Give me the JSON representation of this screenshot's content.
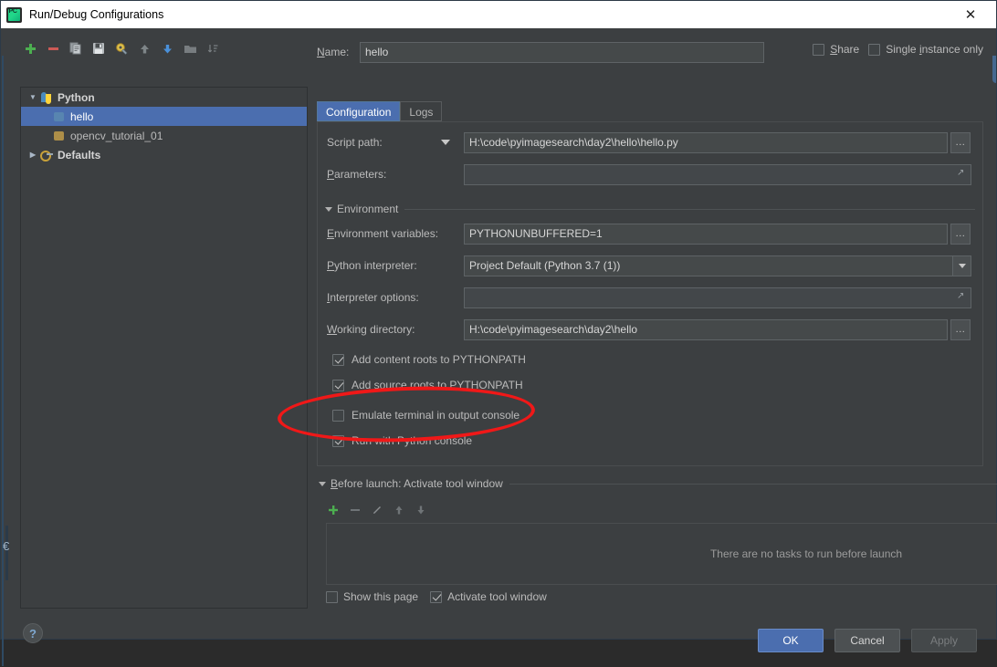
{
  "window": {
    "title": "Run/Debug Configurations",
    "app_icon": "pycharm-logo-icon",
    "close_icon": "close-icon"
  },
  "toolbar": {
    "buttons": [
      {
        "name": "add-configuration-button",
        "icon": "plus-icon",
        "glyph": "+",
        "color": "#4caf50",
        "enabled": true
      },
      {
        "name": "remove-configuration-button",
        "icon": "minus-icon",
        "glyph": "−",
        "color": "#d9534f",
        "enabled": true
      },
      {
        "name": "copy-configuration-button",
        "icon": "copy-icon",
        "glyph": "⎘",
        "color": "#b9bdc0",
        "enabled": true
      },
      {
        "name": "save-configuration-button",
        "icon": "save-icon",
        "glyph": "ὋE",
        "color": "#b9bdc0",
        "enabled": true
      },
      {
        "name": "edit-defaults-button",
        "icon": "gear-key-icon",
        "glyph": "⚙",
        "color": "#d6b34a",
        "enabled": true
      },
      {
        "name": "move-up-button",
        "icon": "arrow-up-icon",
        "glyph": "↑",
        "color": "#7f8486",
        "enabled": false
      },
      {
        "name": "move-down-button",
        "icon": "arrow-down-icon",
        "glyph": "↓",
        "color": "#4a90d9",
        "enabled": true
      },
      {
        "name": "new-folder-button",
        "icon": "folder-icon",
        "glyph": "▬",
        "color": "#8b8f92",
        "enabled": true
      },
      {
        "name": "sort-configurations-button",
        "icon": "sort-icon",
        "glyph": "⇅",
        "color": "#7f8486",
        "enabled": false
      }
    ]
  },
  "tree": {
    "nodes": [
      {
        "label": "Python",
        "level": 0,
        "type": "group",
        "expanded": true,
        "icon": "python-icon",
        "selected": false
      },
      {
        "label": "hello",
        "level": 1,
        "type": "config",
        "icon": "config-icon",
        "selected": true
      },
      {
        "label": "opencv_tutorial_01",
        "level": 1,
        "type": "config",
        "icon": "config-icon",
        "selected": false
      },
      {
        "label": "Defaults",
        "level": 0,
        "type": "group",
        "expanded": false,
        "icon": "defaults-icon",
        "selected": false
      }
    ]
  },
  "header": {
    "name_label": "Name:",
    "name_label_mnemonic": "N",
    "name_value": "hello",
    "share_label": "Share",
    "share_mnemonic": "S",
    "share_checked": false,
    "single_instance_label": "Single instance only",
    "single_instance_mnemonic": "i",
    "single_instance_checked": false
  },
  "tabs": [
    {
      "label": "Configuration",
      "active": true
    },
    {
      "label": "Logs",
      "active": false
    }
  ],
  "form": {
    "script_path": {
      "label": "Script path:",
      "value": "H:\\code\\pyimagesearch\\day2\\hello\\hello.py",
      "browse_label": "...",
      "has_mode_dropdown": true
    },
    "parameters": {
      "label": "Parameters:",
      "mnemonic": "P",
      "value": "",
      "expand_icon": "expand-editor-icon"
    },
    "environment_section": {
      "label": "Environment",
      "expanded": true
    },
    "environment_variables": {
      "label": "Environment variables:",
      "mnemonic": "E",
      "value": "PYTHONUNBUFFERED=1",
      "browse_label": "..."
    },
    "python_interpreter": {
      "label": "Python interpreter:",
      "mnemonic": "P",
      "value": "Project Default (Python 3.7 (1))"
    },
    "interpreter_options": {
      "label": "Interpreter options:",
      "mnemonic": "I",
      "value": "",
      "expand_icon": "expand-editor-icon"
    },
    "working_directory": {
      "label": "Working directory:",
      "mnemonic": "W",
      "value": "H:\\code\\pyimagesearch\\day2\\hello",
      "browse_label": "..."
    },
    "checkboxes": [
      {
        "label": "Add content roots to PYTHONPATH",
        "checked": true,
        "name": "add-content-roots-checkbox"
      },
      {
        "label": "Add source roots to PYTHONPATH",
        "checked": true,
        "name": "add-source-roots-checkbox"
      },
      {
        "label": "Emulate terminal in output console",
        "checked": false,
        "name": "emulate-terminal-checkbox"
      },
      {
        "label": "Run with Python console",
        "checked": true,
        "name": "run-with-python-console-checkbox"
      }
    ]
  },
  "before_launch": {
    "section_label": "Before launch: Activate tool window",
    "mnemonic": "B",
    "expanded": true,
    "toolbar": [
      {
        "name": "bl-add-button",
        "icon": "plus-icon",
        "glyph": "+",
        "color": "#4caf50",
        "enabled": true
      },
      {
        "name": "bl-remove-button",
        "icon": "minus-icon",
        "glyph": "−",
        "color": "#7f8486",
        "enabled": false
      },
      {
        "name": "bl-edit-button",
        "icon": "pencil-icon",
        "glyph": "✎",
        "color": "#8b8f92",
        "enabled": false
      },
      {
        "name": "bl-move-up-button",
        "icon": "arrow-up-icon",
        "glyph": "↑",
        "color": "#7f8486",
        "enabled": false
      },
      {
        "name": "bl-move-down-button",
        "icon": "arrow-down-icon",
        "glyph": "↓",
        "color": "#7f8486",
        "enabled": false
      }
    ],
    "empty_text": "There are no tasks to run before launch",
    "show_this_page": {
      "label": "Show this page",
      "checked": false
    },
    "activate_tool_window": {
      "label": "Activate tool window",
      "checked": true
    }
  },
  "footer": {
    "help_label": "?",
    "ok_label": "OK",
    "cancel_label": "Cancel",
    "apply_label": "Apply",
    "apply_enabled": false
  },
  "annotation": {
    "shape": "ellipse",
    "color": "#f01818",
    "targets": "Run with Python console"
  },
  "colors": {
    "window_bg": "#3c3f41",
    "titlebar_bg": "#ffffff",
    "selection_blue": "#4b6eaf",
    "input_bg": "#45494a",
    "text": "#bbbbbb",
    "annotation_red": "#f01818"
  }
}
